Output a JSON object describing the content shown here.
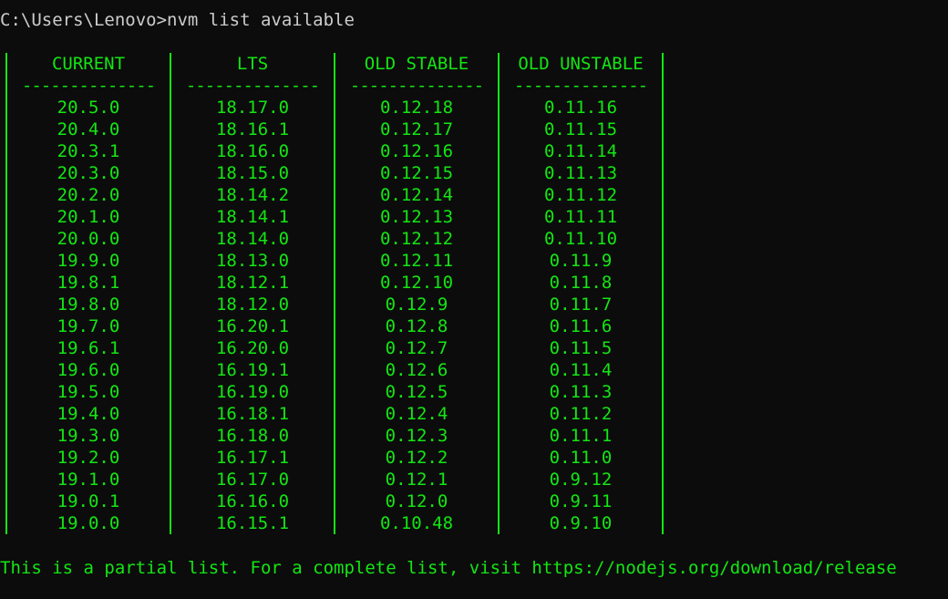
{
  "terminal": {
    "prompt": "C:\\Users\\Lenovo>nvm list available",
    "table": {
      "headers": [
        "CURRENT",
        "LTS",
        "OLD STABLE",
        "OLD UNSTABLE"
      ],
      "rows": [
        [
          "20.5.0",
          "18.17.0",
          "0.12.18",
          "0.11.16"
        ],
        [
          "20.4.0",
          "18.16.1",
          "0.12.17",
          "0.11.15"
        ],
        [
          "20.3.1",
          "18.16.0",
          "0.12.16",
          "0.11.14"
        ],
        [
          "20.3.0",
          "18.15.0",
          "0.12.15",
          "0.11.13"
        ],
        [
          "20.2.0",
          "18.14.2",
          "0.12.14",
          "0.11.12"
        ],
        [
          "20.1.0",
          "18.14.1",
          "0.12.13",
          "0.11.11"
        ],
        [
          "20.0.0",
          "18.14.0",
          "0.12.12",
          "0.11.10"
        ],
        [
          "19.9.0",
          "18.13.0",
          "0.12.11",
          "0.11.9"
        ],
        [
          "19.8.1",
          "18.12.1",
          "0.12.10",
          "0.11.8"
        ],
        [
          "19.8.0",
          "18.12.0",
          "0.12.9",
          "0.11.7"
        ],
        [
          "19.7.0",
          "16.20.1",
          "0.12.8",
          "0.11.6"
        ],
        [
          "19.6.1",
          "16.20.0",
          "0.12.7",
          "0.11.5"
        ],
        [
          "19.6.0",
          "16.19.1",
          "0.12.6",
          "0.11.4"
        ],
        [
          "19.5.0",
          "16.19.0",
          "0.12.5",
          "0.11.3"
        ],
        [
          "19.4.0",
          "16.18.1",
          "0.12.4",
          "0.11.2"
        ],
        [
          "19.3.0",
          "16.18.0",
          "0.12.3",
          "0.11.1"
        ],
        [
          "19.2.0",
          "16.17.1",
          "0.12.2",
          "0.11.0"
        ],
        [
          "19.1.0",
          "16.17.0",
          "0.12.1",
          "0.9.12"
        ],
        [
          "19.0.1",
          "16.16.0",
          "0.12.0",
          "0.9.11"
        ],
        [
          "19.0.0",
          "16.15.1",
          "0.10.48",
          "0.9.10"
        ]
      ]
    },
    "footer": "This is a partial list. For a complete list, visit https://nodejs.org/download/release",
    "colors": {
      "background": "#0c0c0c",
      "text": "#cccccc",
      "output": "#13e613"
    }
  }
}
